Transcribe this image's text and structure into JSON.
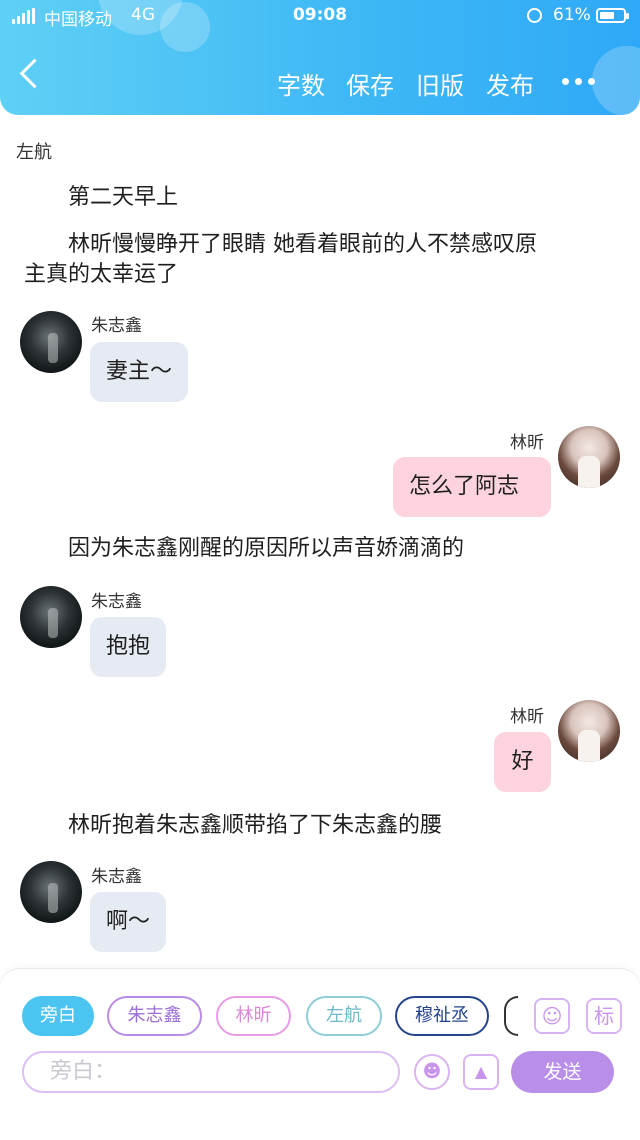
{
  "status_bar": {
    "carrier": "中国移动",
    "network": "4G",
    "time": "09:08",
    "battery": "61%"
  },
  "header": {
    "buttons": {
      "word_count": "字数",
      "save": "保存",
      "old_version": "旧版",
      "publish": "发布"
    }
  },
  "author_label": "左航",
  "messages": [
    {
      "type": "narration",
      "text": "第二天早上"
    },
    {
      "type": "narration",
      "text": "林昕慢慢睁开了眼睛 她看着眼前的人不禁感叹原"
    },
    {
      "type": "narration",
      "text": "主真的太幸运了"
    },
    {
      "type": "left",
      "name": "朱志鑫",
      "text": "妻主～"
    },
    {
      "type": "right",
      "name": "林昕",
      "text": "怎么了阿志"
    },
    {
      "type": "narration",
      "text": "因为朱志鑫刚醒的原因所以声音娇滴滴的"
    },
    {
      "type": "left",
      "name": "朱志鑫",
      "text": "抱抱"
    },
    {
      "type": "right",
      "name": "林昕",
      "text": "好"
    },
    {
      "type": "narration",
      "text": "林昕抱着朱志鑫顺带掐了下朱志鑫的腰"
    },
    {
      "type": "left",
      "name": "朱志鑫",
      "text": "啊～"
    }
  ],
  "composer": {
    "chips": [
      "旁白",
      "朱志鑫",
      "林昕",
      "左航",
      "穆祉丞"
    ],
    "chip_colors": [
      "#4cc4f2",
      "#b98ce6",
      "#e79ce6",
      "#8ecdd9",
      "#25448c"
    ],
    "tool_icon_label": "标",
    "input_placeholder": "旁白：",
    "send_label": "发送"
  }
}
